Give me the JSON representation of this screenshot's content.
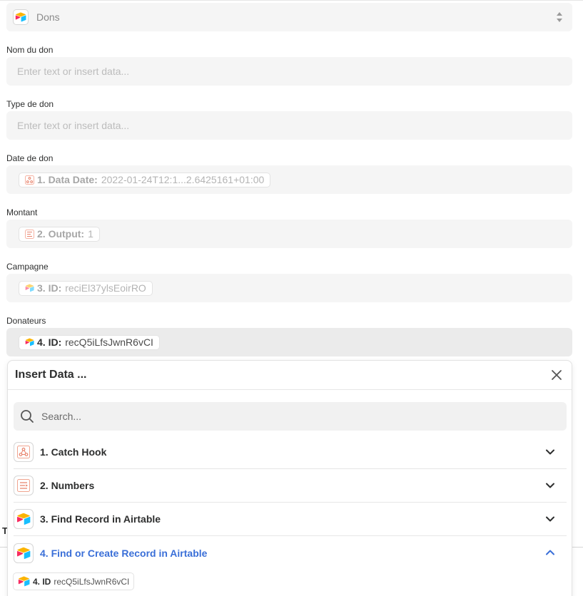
{
  "app_select": {
    "label": "Dons"
  },
  "fields": [
    {
      "label": "Nom du don",
      "placeholder": "Enter text or insert data..."
    },
    {
      "label": "Type de don",
      "placeholder": "Enter text or insert data..."
    },
    {
      "label": "Date de don",
      "pill": {
        "key": "1. Data Date:",
        "value": "2022-01-24T12:1...2.6425161+01:00",
        "icon": "webhook-icon"
      }
    },
    {
      "label": "Montant",
      "pill": {
        "key": "2. Output:",
        "value": "1",
        "icon": "numbers-icon"
      }
    },
    {
      "label": "Campagne",
      "pill": {
        "key": "3. ID:",
        "value": "reciEl37ylsEoirRO",
        "icon": "airtable-icon"
      }
    },
    {
      "label": "Donateurs",
      "pill": {
        "key": "4. ID:",
        "value": "recQ5iLfsJwnR6vCI",
        "icon": "airtable-icon"
      }
    }
  ],
  "insert_data": {
    "title": "Insert Data ...",
    "search_placeholder": "Search...",
    "steps": [
      {
        "label": "1. Catch Hook",
        "icon": "webhook-icon",
        "expanded": false
      },
      {
        "label": "2. Numbers",
        "icon": "numbers-icon",
        "expanded": false
      },
      {
        "label": "3. Find Record in Airtable",
        "icon": "airtable-icon",
        "expanded": false
      },
      {
        "label": "4. Find or Create Record in Airtable",
        "icon": "airtable-icon",
        "expanded": true
      }
    ],
    "result": {
      "key": "4. ID",
      "value": "recQ5iLfsJwnR6vCI"
    }
  },
  "background": {
    "partial_letter": "T"
  },
  "colors": {
    "accent": "#3a6fd8",
    "field_bg": "#f5f5f5",
    "text": "#2d2e2e"
  }
}
